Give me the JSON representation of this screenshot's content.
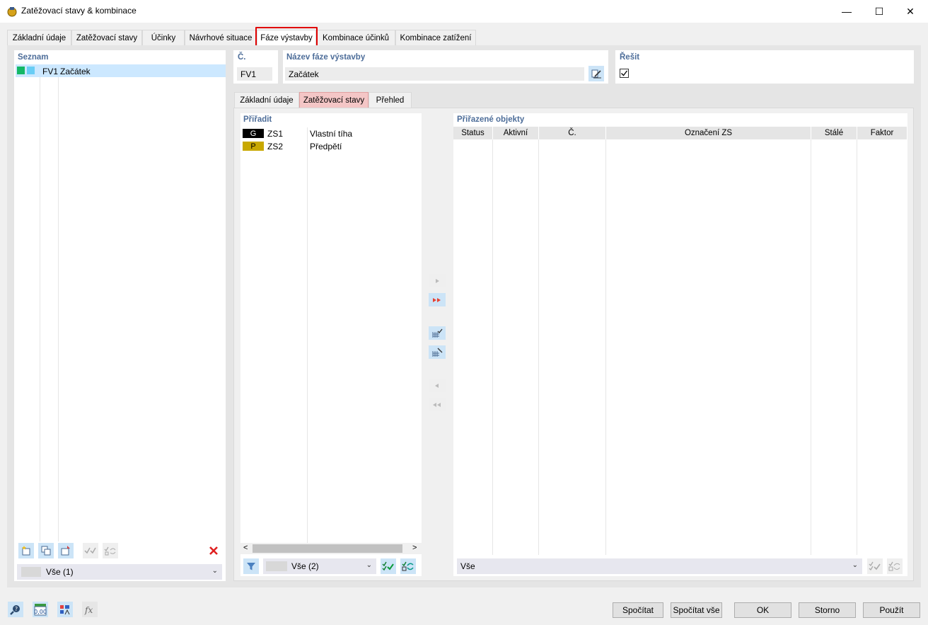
{
  "window": {
    "title": "Zatěžovací stavy & kombinace",
    "minimize": "—",
    "maximize": "☐",
    "close": "✕"
  },
  "main_tabs": [
    {
      "label": "Základní údaje"
    },
    {
      "label": "Zatěžovací stavy"
    },
    {
      "label": "Účinky"
    },
    {
      "label": "Návrhové situace"
    },
    {
      "label": "Fáze výstavby"
    },
    {
      "label": "Kombinace účinků"
    },
    {
      "label": "Kombinace zatížení"
    }
  ],
  "list": {
    "title": "Seznam",
    "items": [
      {
        "id": "FV1",
        "name": "Začátek",
        "colors": [
          "#14b866",
          "#69cdf5"
        ]
      }
    ],
    "filter_value": "Vše (1)"
  },
  "header": {
    "number_label": "Č.",
    "number_value": "FV1",
    "name_label": "Název fáze výstavby",
    "name_value": "Začátek",
    "solve_label": "Řešit",
    "solve_checked": true
  },
  "sub_tabs": [
    {
      "label": "Základní údaje"
    },
    {
      "label": "Zatěžovací stavy"
    },
    {
      "label": "Přehled"
    }
  ],
  "assign": {
    "title": "Přiřadit",
    "items": [
      {
        "badge": "G",
        "badge_bg": "#000000",
        "badge_fg": "#ffffff",
        "id": "ZS1",
        "name": "Vlastní tíha"
      },
      {
        "badge": "P",
        "badge_bg": "#c8a800",
        "badge_fg": "#000000",
        "id": "ZS2",
        "name": "Předpětí"
      }
    ],
    "filter_value": "Vše (2)",
    "scroll_left": "<",
    "scroll_right": ">"
  },
  "assigned": {
    "title": "Přiřazené objekty",
    "columns": [
      "Status",
      "Aktivní",
      "Č.",
      "Označení ZS",
      "Stálé",
      "Faktor"
    ],
    "rows": [],
    "filter_value": "Vše"
  },
  "bottom_buttons": {
    "calculate": "Spočítat",
    "calculate_all": "Spočítat vše",
    "ok": "OK",
    "cancel": "Storno",
    "apply": "Použít"
  },
  "colors": {
    "accent": "#4d6d99",
    "highlight": "#e00000",
    "selected_row": "#cce8ff",
    "active_subtab": "#f4c6c6"
  }
}
